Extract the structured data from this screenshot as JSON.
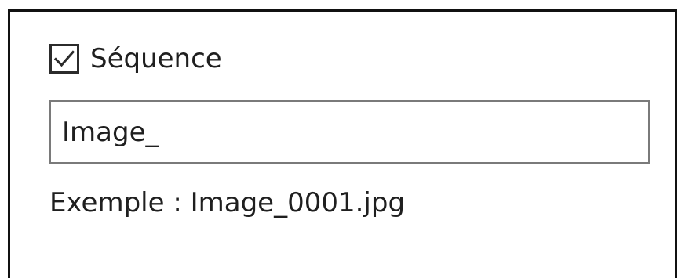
{
  "sequence": {
    "checked": true,
    "label": "Séquence"
  },
  "prefix_input": {
    "value": "Image_"
  },
  "example": {
    "text": "Exemple : Image_0001.jpg"
  },
  "icons": {
    "checkmark": "check-icon"
  }
}
